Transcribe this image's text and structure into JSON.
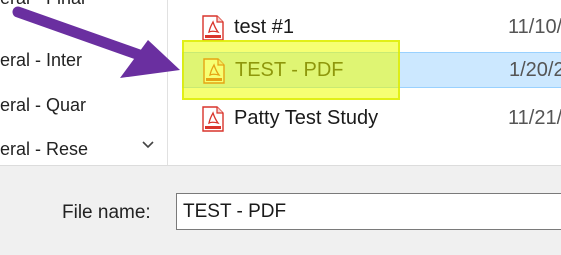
{
  "sidebar": {
    "items": [
      {
        "label": "eral - Final"
      },
      {
        "label": "eral - Inter"
      },
      {
        "label": "eral - Quar"
      },
      {
        "label": "eral - Rese"
      }
    ]
  },
  "files": [
    {
      "name": "test #1",
      "date": "11/10/",
      "selected": false
    },
    {
      "name": "TEST - PDF",
      "date": "1/20/2",
      "selected": true
    },
    {
      "name": "Patty Test Study",
      "date": "11/21/",
      "selected": false
    }
  ],
  "footer": {
    "filename_label": "File name:",
    "filename_value": "TEST - PDF"
  },
  "colors": {
    "selection": "#cce8ff",
    "highlight": "#eeff00",
    "arrow": "#6a2fa0",
    "pdf_icon": "#d9342b"
  },
  "icons": {
    "file": "pdf-file-icon",
    "scroll": "chevron-down-icon"
  }
}
